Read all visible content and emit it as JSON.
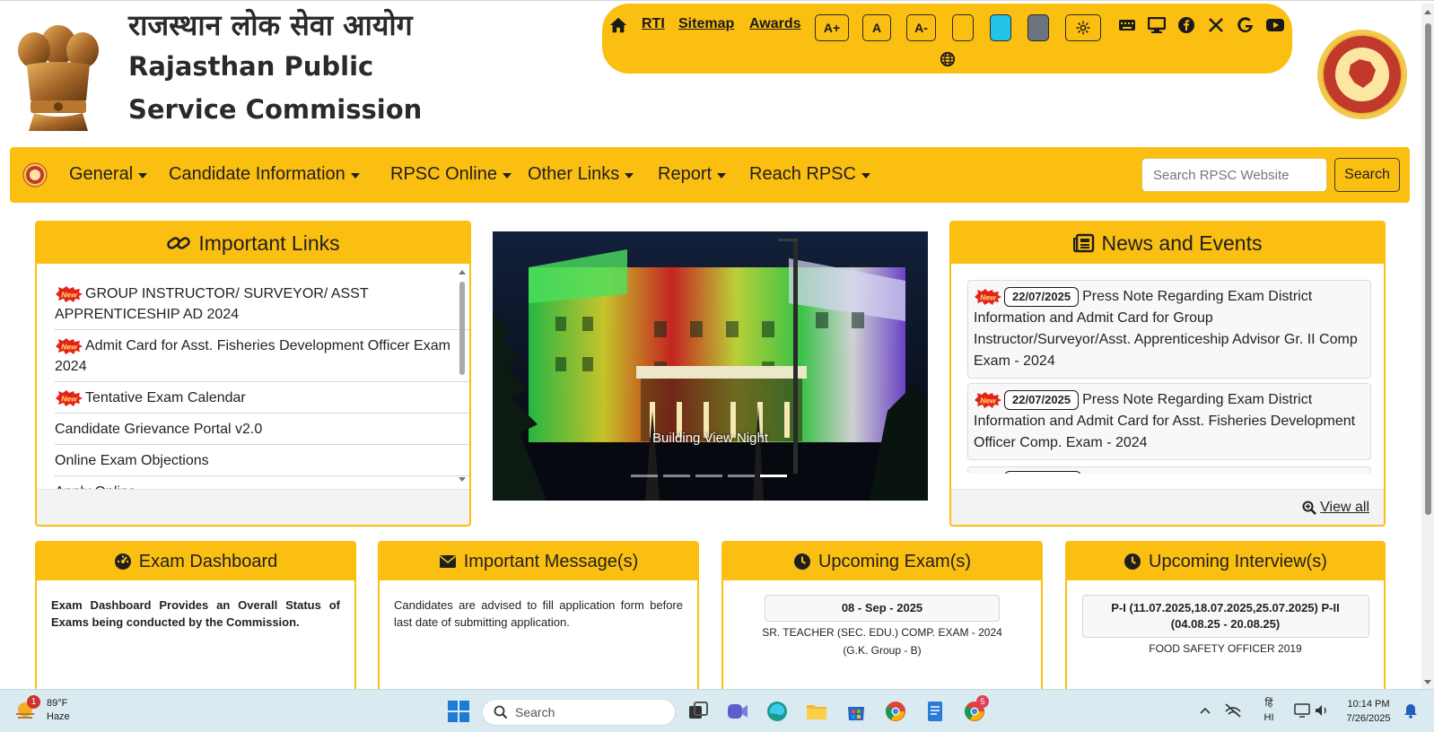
{
  "header": {
    "title_hindi": "राजस्थान लोक सेवा आयोग",
    "title_english": "Rajasthan Public Service Commission"
  },
  "toolbar": {
    "home_icon": "home-icon",
    "rti_label": "RTI",
    "sitemap_label": "Sitemap",
    "awards_label": "Awards",
    "font_increase_label": "A+",
    "font_normal_label": "A",
    "font_decrease_label": "A-",
    "theme_colors": [
      "#fbbf12",
      "#22c4e8",
      "#6c757d"
    ],
    "icons": [
      "gear-icon",
      "keyboard-icon",
      "monitor-icon",
      "facebook-icon",
      "x-icon",
      "google-icon",
      "youtube-icon",
      "globe-icon"
    ]
  },
  "nav": {
    "items": [
      {
        "label": "General"
      },
      {
        "label": "Candidate Information"
      },
      {
        "label": "RPSC Online"
      },
      {
        "label": "Other Links"
      },
      {
        "label": "Report"
      },
      {
        "label": "Reach RPSC"
      }
    ],
    "search_placeholder": "Search RPSC Website",
    "search_button": "Search"
  },
  "important_links": {
    "title": "Important Links",
    "new_badge_text": "New",
    "items": [
      {
        "label": "GROUP INSTRUCTOR/ SURVEYOR/ ASST APPRENTICESHIP AD 2024",
        "is_new": true
      },
      {
        "label": "Admit Card for Asst. Fisheries Development Officer Exam 2024",
        "is_new": true
      },
      {
        "label": "Tentative Exam Calendar",
        "is_new": true
      },
      {
        "label": "Candidate Grievance Portal v2.0",
        "is_new": false
      },
      {
        "label": "Online Exam Objections",
        "is_new": false
      },
      {
        "label": "Apply Online",
        "is_new": false
      }
    ]
  },
  "carousel": {
    "caption": "Building View Night",
    "slide_count": 5,
    "active_index": 4
  },
  "news": {
    "title": "News and Events",
    "items": [
      {
        "date": "22/07/2025",
        "text": "Press Note Regarding Exam District Information and Admit Card for Group Instructor/Surveyor/Asst. Apprenticeship Advisor Gr. II Comp Exam - 2024"
      },
      {
        "date": "22/07/2025",
        "text": "Press Note Regarding Exam District Information and Admit Card for Asst. Fisheries Development Officer Comp. Exam - 2024"
      },
      {
        "date": "",
        "text": ""
      }
    ],
    "view_all": "View all"
  },
  "exam_dashboard": {
    "title": "Exam Dashboard",
    "text": "Exam Dashboard Provides an Overall Status of Exams being conducted by the Commission."
  },
  "important_message": {
    "title": "Important Message(s)",
    "text": "Candidates are advised to fill application form before last date of submitting application."
  },
  "upcoming_exams": {
    "title": "Upcoming Exam(s)",
    "date": "08 - Sep - 2025",
    "line1": "SR. TEACHER (SEC. EDU.) COMP. EXAM - 2024",
    "line2": "(G.K. Group - B)"
  },
  "upcoming_interviews": {
    "title": "Upcoming Interview(s)",
    "date": "P-I (11.07.2025,18.07.2025,25.07.2025) P-II (04.08.25 - 20.08.25)",
    "line1": "FOOD SAFETY OFFICER 2019"
  },
  "taskbar": {
    "weather_badge": "1",
    "temperature": "89°F",
    "condition": "Haze",
    "search_placeholder": "Search",
    "chrome_badge": "5",
    "language_top": "हिं",
    "language_bottom": "HI",
    "time": "10:14 PM",
    "date": "7/26/2025"
  }
}
